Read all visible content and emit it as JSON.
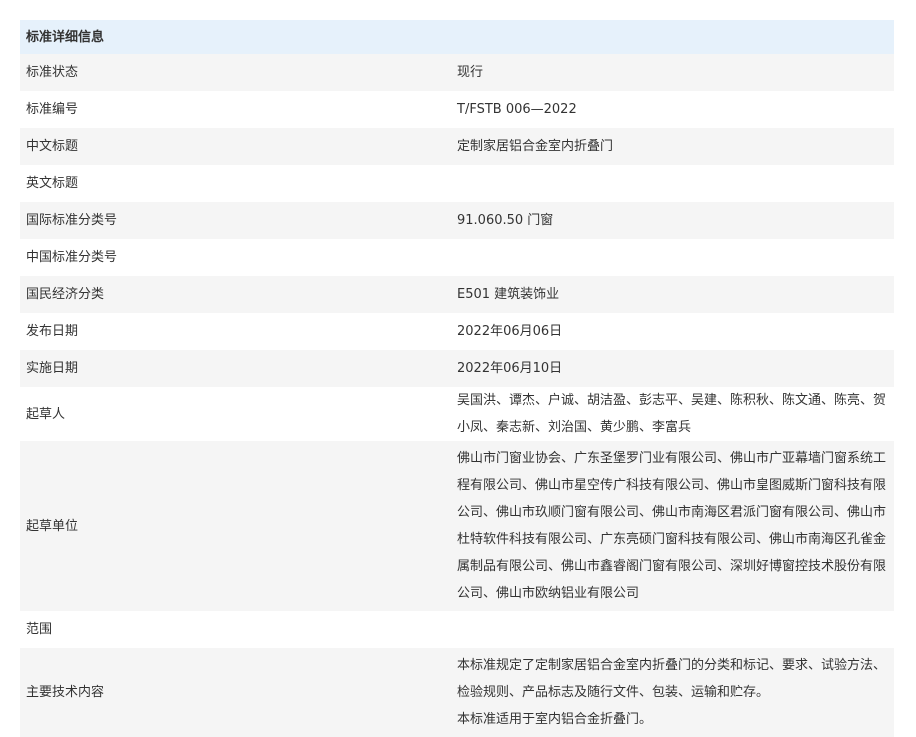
{
  "section_title": "标准详细信息",
  "rows": [
    {
      "label": "标准状态",
      "value": "现行"
    },
    {
      "label": "标准编号",
      "value": "T/FSTB 006—2022"
    },
    {
      "label": "中文标题",
      "value": "定制家居铝合金室内折叠门"
    },
    {
      "label": "英文标题",
      "value": ""
    },
    {
      "label": "国际标准分类号",
      "value": "91.060.50 门窗"
    },
    {
      "label": "中国标准分类号",
      "value": ""
    },
    {
      "label": "国民经济分类",
      "value": "E501 建筑装饰业"
    },
    {
      "label": "发布日期",
      "value": "2022年06月06日"
    },
    {
      "label": "实施日期",
      "value": "2022年06月10日"
    },
    {
      "label": "起草人",
      "value": "吴国洪、谭杰、户诚、胡洁盈、彭志平、吴建、陈积秋、陈文通、陈亮、贺小凤、秦志新、刘治国、黄少鹏、李富兵"
    },
    {
      "label": "起草单位",
      "value": "佛山市门窗业协会、广东圣堡罗门业有限公司、佛山市广亚幕墙门窗系统工程有限公司、佛山市星空传广科技有限公司、佛山市皇图威斯门窗科技有限公司、佛山市玖顺门窗有限公司、佛山市南海区君派门窗有限公司、佛山市杜特软件科技有限公司、广东亮硕门窗科技有限公司、佛山市南海区孔雀金属制品有限公司、佛山市鑫睿阁门窗有限公司、深圳好博窗控技术股份有限公司、佛山市欧纳铝业有限公司"
    },
    {
      "label": "范围",
      "value": ""
    },
    {
      "label": "主要技术内容",
      "value_lines": [
        "本标准规定了定制家居铝合金室内折叠门的分类和标记、要求、试验方法、检验规则、产品标志及随行文件、包装、运输和贮存。",
        "本标准适用于室内铝合金折叠门。"
      ]
    }
  ]
}
